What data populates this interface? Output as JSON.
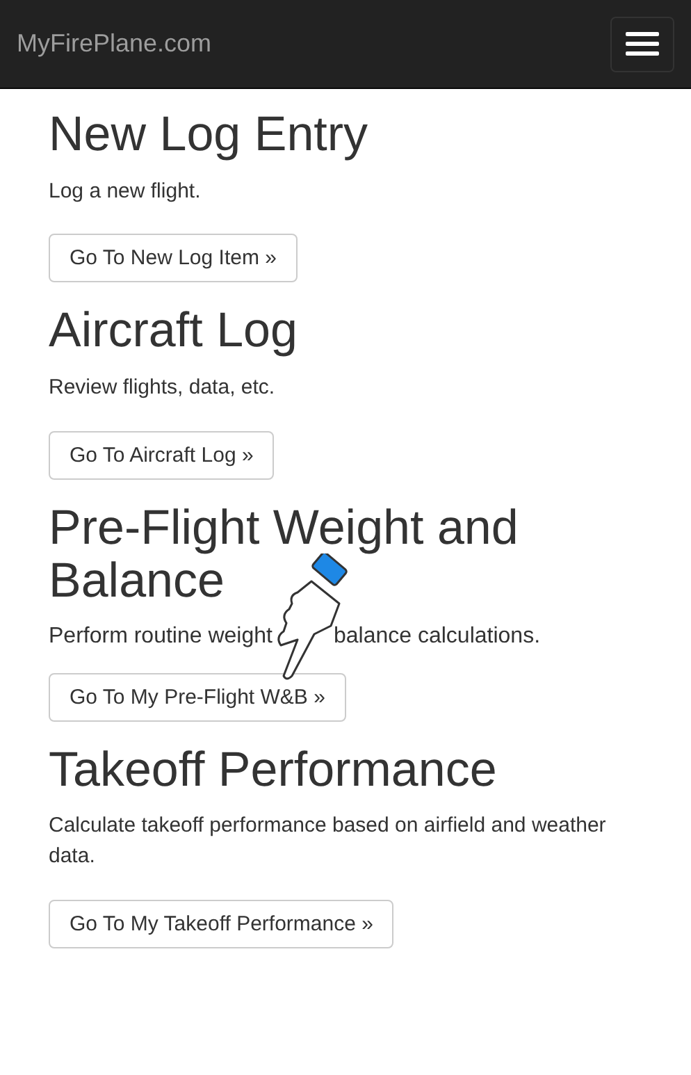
{
  "navbar": {
    "brand": "MyFirePlane.com"
  },
  "sections": [
    {
      "heading": "New Log Entry",
      "text": "Log a new flight.",
      "button": "Go To New Log Item »"
    },
    {
      "heading": "Aircraft Log",
      "text": "Review flights, data, etc.",
      "button": "Go To Aircraft Log »"
    },
    {
      "heading": "Pre-Flight Weight and Balance",
      "text_parts": [
        "Perform routine weight",
        "balance calculations."
      ],
      "button": "Go To My Pre-Flight W&B »",
      "touch_indicator": true
    },
    {
      "heading": "Takeoff Performance",
      "text": "Calculate takeoff performance based on airfield and weather data.",
      "button": "Go To My Takeoff Performance »"
    }
  ]
}
